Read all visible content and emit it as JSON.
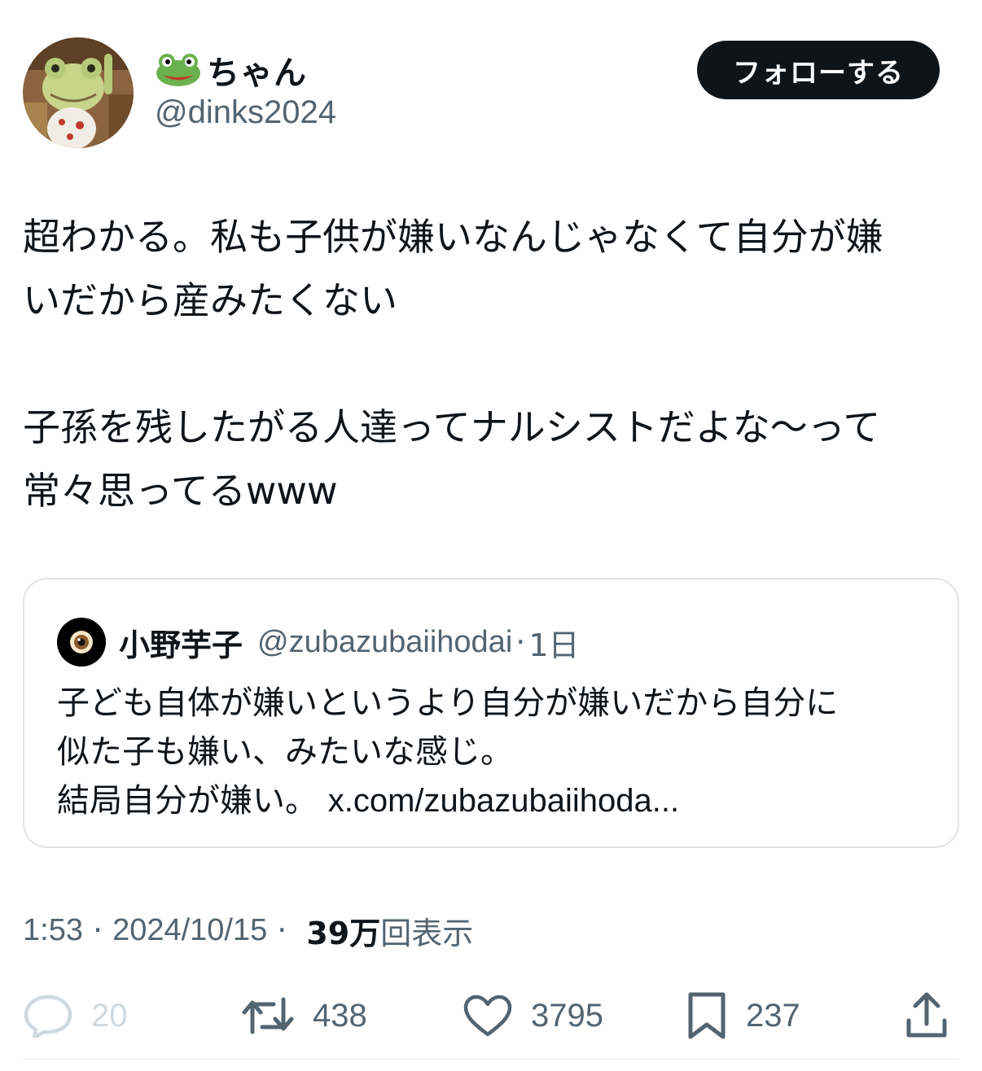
{
  "author": {
    "display_name": "ちゃん",
    "name_emoji": "frog-face-emoji",
    "handle": "@dinks2024",
    "avatar": "frog-figurine-avatar"
  },
  "follow_button_label": "フォローする",
  "tweet": {
    "text": "超わかる。私も子供が嫌いなんじゃなくて自分が嫌\nいだから産みたくない\n\n子孫を残したがる人達ってナルシストだよな〜って\n常々思ってるwww"
  },
  "quote": {
    "avatar": "eye-avatar",
    "name": "小野芋子",
    "handle": "@zubazubaiihodai",
    "separator": "·",
    "time": "1日",
    "text": "子ども自体が嫌いというより自分が嫌いだから自分に\n似た子も嫌い、みたいな感じ。\n結局自分が嫌い。 ",
    "link": "x.com/zubazubaiihoda..."
  },
  "meta": {
    "time": "1:53",
    "separator": "·",
    "date": "2024/10/15",
    "views_count": "39万",
    "views_label": "回表示"
  },
  "actions": {
    "reply_count": "20",
    "retweet_count": "438",
    "like_count": "3795",
    "bookmark_count": "237"
  },
  "colors": {
    "text_primary": "#0f1419",
    "text_secondary": "#536471",
    "disabled": "#cfd9de",
    "border": "#dfe3e6",
    "button_bg": "#0f1419"
  }
}
